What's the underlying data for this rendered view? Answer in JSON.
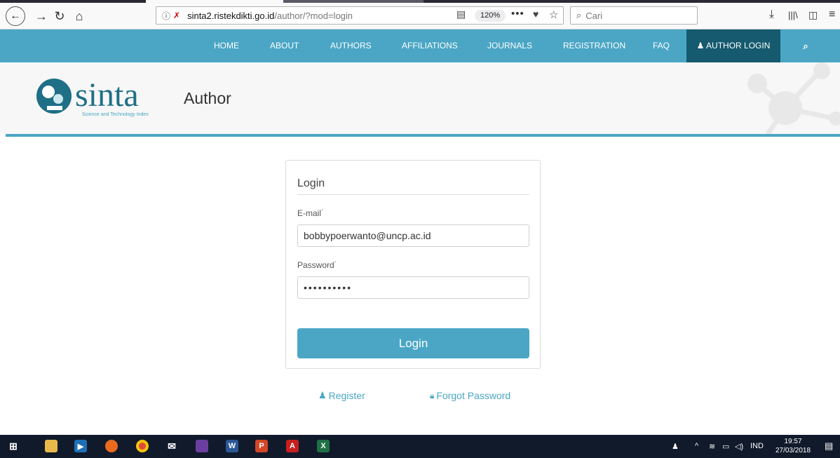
{
  "browser": {
    "url_domain": "sinta2.ristekdikti.go.id",
    "url_path": "/author/?mod=login",
    "zoom": "120%",
    "search_placeholder": "Cari"
  },
  "nav": {
    "items": [
      {
        "label": "HOME"
      },
      {
        "label": "ABOUT"
      },
      {
        "label": "AUTHORS"
      },
      {
        "label": "AFFILIATIONS"
      },
      {
        "label": "JOURNALS"
      },
      {
        "label": "REGISTRATION"
      },
      {
        "label": "FAQ"
      }
    ],
    "author_login": "AUTHOR LOGIN"
  },
  "header": {
    "logo_text": "sinta",
    "logo_tagline": "Science and Technology Index",
    "title": "Author"
  },
  "login": {
    "title": "Login",
    "email_label": "E-mail",
    "email_value": "bobbypoerwanto@uncp.ac.id",
    "password_label": "Password",
    "password_value": "••••••••••",
    "button": "Login",
    "register": "Register",
    "forgot": "Forgot Password"
  },
  "taskbar": {
    "time": "19:57",
    "date": "27/03/2018",
    "lang": "IND"
  },
  "colors": {
    "accent": "#4aa6c4",
    "dark_accent": "#155a6e"
  }
}
